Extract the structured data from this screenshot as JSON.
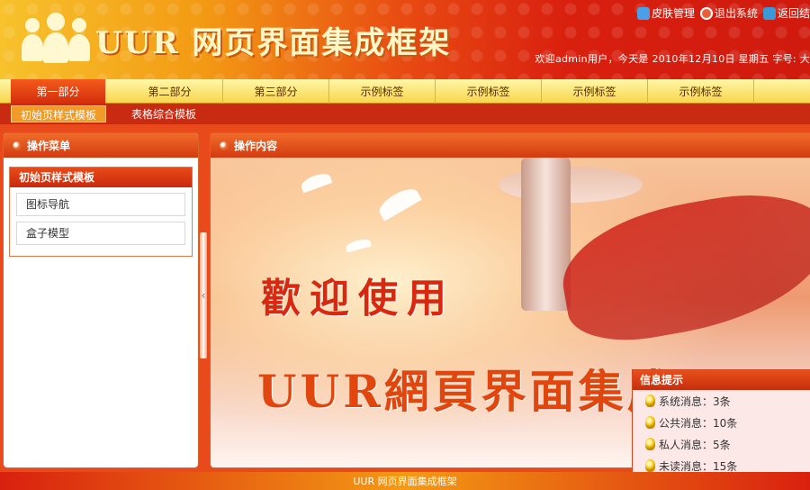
{
  "header": {
    "logo_text": "UUR 网页界面集成框架",
    "top_links": [
      {
        "label": "皮肤管理",
        "icon": "skin-icon",
        "color": "#4aa0e8"
      },
      {
        "label": "退出系统",
        "icon": "logout-icon",
        "color": "#e8603a"
      },
      {
        "label": "返回结",
        "icon": "home-icon",
        "color": "#3a9ad8"
      }
    ],
    "welcome_text": "欢迎admin用户，今天是 2010年12月10日 星期五  字号: 大"
  },
  "nav": {
    "tabs": [
      {
        "label": "第一部分"
      },
      {
        "label": "第二部分"
      },
      {
        "label": "第三部分"
      },
      {
        "label": "示例标签"
      },
      {
        "label": "示例标签"
      },
      {
        "label": "示例标签"
      },
      {
        "label": "示例标签"
      }
    ],
    "sub_items": [
      {
        "label": "初始页样式模板"
      },
      {
        "label": "表格综合模板"
      }
    ]
  },
  "left_panel": {
    "title": "操作菜单",
    "group_title": "初始页样式模板",
    "items": [
      {
        "label": "图标导航"
      },
      {
        "label": "盒子模型"
      }
    ]
  },
  "right_panel": {
    "title": "操作内容",
    "welcome_line1": "歡迎使用",
    "welcome_line2": "UUR網頁界面集成"
  },
  "info_box": {
    "title": "信息提示",
    "items": [
      {
        "label": "系统消息：3条"
      },
      {
        "label": "公共消息：10条"
      },
      {
        "label": "私人消息：5条"
      },
      {
        "label": "未读消息：15条"
      }
    ]
  },
  "footer": {
    "text": "UUR 网页界面集成框架"
  },
  "colors": {
    "primary_red": "#d32e0c",
    "nav_yellow": "#f8d64c",
    "accent_orange": "#f09a28"
  }
}
